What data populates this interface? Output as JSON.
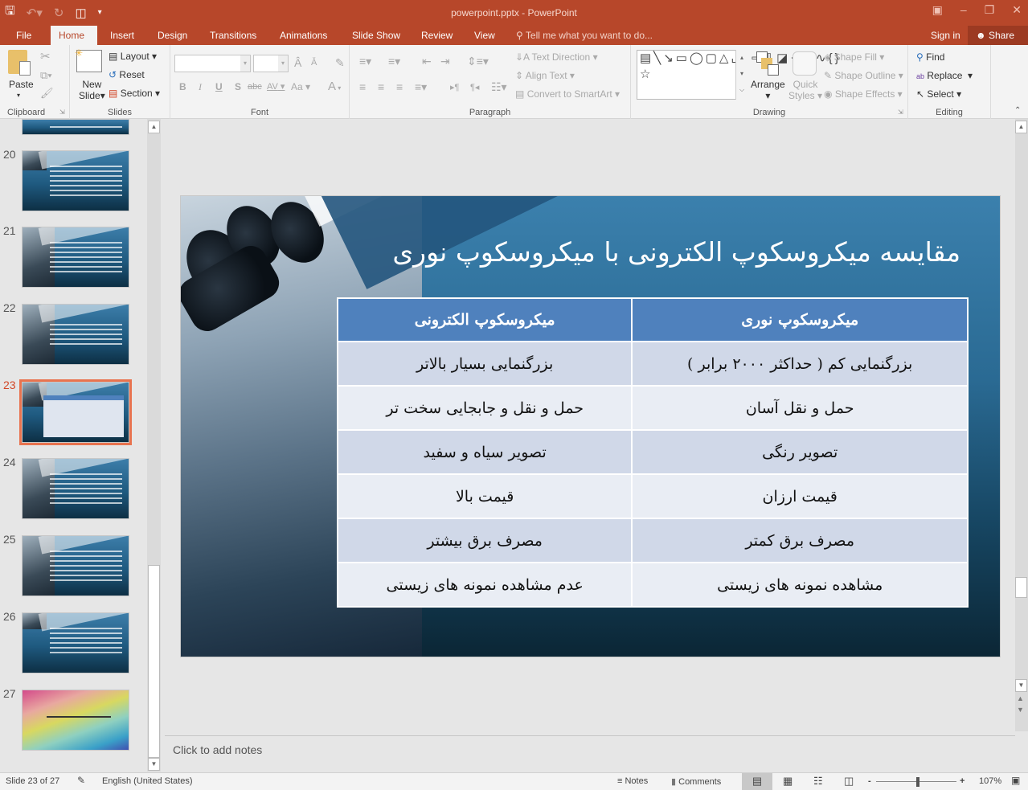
{
  "window": {
    "title": "powerpoint.pptx - PowerPoint",
    "quick_access": [
      "save-icon",
      "undo-icon",
      "redo-icon",
      "start-from-beginning-icon",
      "customize-qat-icon"
    ]
  },
  "tabs": [
    "File",
    "Home",
    "Insert",
    "Design",
    "Transitions",
    "Animations",
    "Slide Show",
    "Review",
    "View"
  ],
  "active_tab": "Home",
  "tell_me": "Tell me what you want to do...",
  "sign_in": "Sign in",
  "share": "Share",
  "ribbon": {
    "clipboard": {
      "label": "Clipboard",
      "paste": "Paste"
    },
    "slides": {
      "label": "Slides",
      "new_slide_1": "New",
      "new_slide_2": "Slide",
      "layout": "Layout",
      "reset": "Reset",
      "section": "Section"
    },
    "font": {
      "label": "Font",
      "font_name": "",
      "font_size": "",
      "bold": "B",
      "italic": "I",
      "underline": "U",
      "shadow": "S",
      "strike": "abc",
      "spacing": "AV",
      "case": "Aa",
      "color": "A"
    },
    "paragraph": {
      "label": "Paragraph",
      "text_direction": "Text Direction",
      "align_text": "Align Text",
      "convert_smartart": "Convert to SmartArt"
    },
    "drawing": {
      "label": "Drawing",
      "arrange": "Arrange",
      "quick_styles_1": "Quick",
      "quick_styles_2": "Styles",
      "shape_fill": "Shape Fill",
      "shape_outline": "Shape Outline",
      "shape_effects": "Shape Effects"
    },
    "editing": {
      "label": "Editing",
      "find": "Find",
      "replace": "Replace",
      "select": "Select"
    }
  },
  "thumbnails": [
    {
      "num": "20"
    },
    {
      "num": "21"
    },
    {
      "num": "22"
    },
    {
      "num": "23",
      "selected": true
    },
    {
      "num": "24"
    },
    {
      "num": "25"
    },
    {
      "num": "26"
    },
    {
      "num": "27"
    }
  ],
  "slide": {
    "title": "مقایسه میکروسکوپ الکترونی با میکروسکوپ نوری",
    "table": {
      "headers": [
        "میکروسکوپ نوری",
        "میکروسکوپ الکترونی"
      ],
      "rows": [
        [
          "بزرگنمایی کم ( حداکثر ۲۰۰۰ برابر )",
          "بزرگنمایی بسیار بالاتر"
        ],
        [
          "حمل و نقل آسان",
          "حمل و نقل و جابجایی سخت تر"
        ],
        [
          "تصویر رنگی",
          "تصویر سیاه و سفید"
        ],
        [
          "قیمت ارزان",
          "قیمت بالا"
        ],
        [
          "مصرف برق کمتر",
          "مصرف برق بیشتر"
        ],
        [
          "مشاهده نمونه های زیستی",
          "عدم مشاهده نمونه های زیستی"
        ]
      ]
    }
  },
  "notes_placeholder": "Click to add notes",
  "status": {
    "slide_info": "Slide 23 of 27",
    "language": "English (United States)",
    "notes": "Notes",
    "comments": "Comments",
    "zoom": "107%",
    "zoom_minus": "-",
    "zoom_plus": "+"
  },
  "colors": {
    "accent": "#b7472a",
    "table_header": "#4f81bd",
    "selection": "#e8734f"
  }
}
